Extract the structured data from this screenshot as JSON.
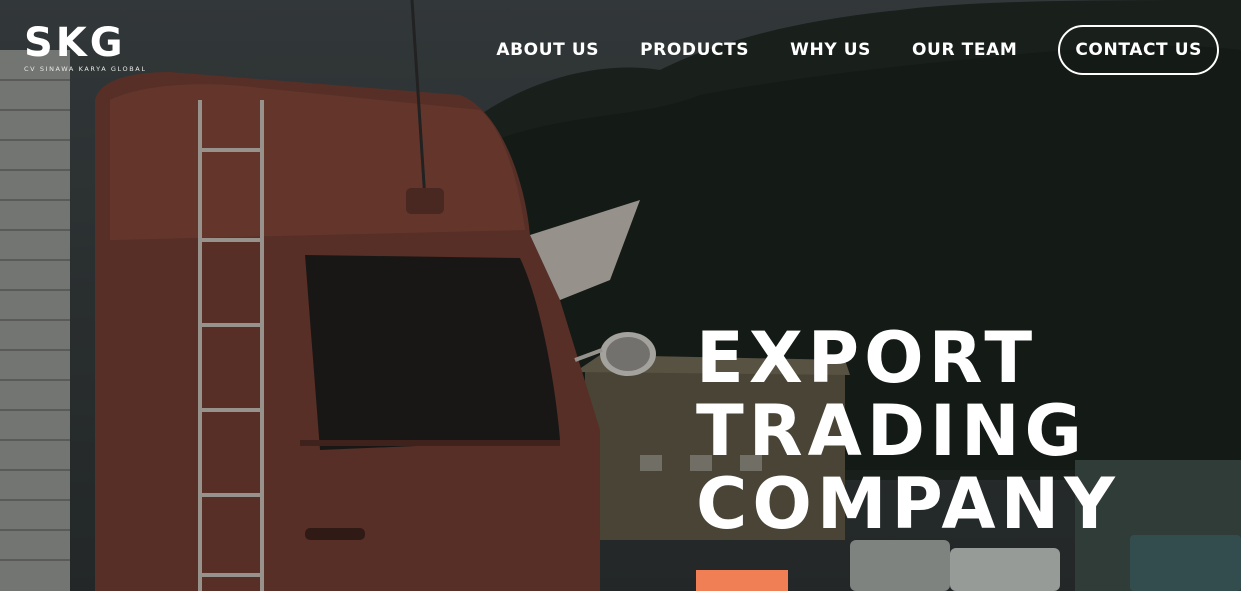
{
  "brand": {
    "logo_mark": "SKG",
    "logo_subtitle": "CV SINAWA KARYA GLOBAL"
  },
  "nav": {
    "items": [
      {
        "label": "ABOUT US"
      },
      {
        "label": "PRODUCTS"
      },
      {
        "label": "WHY US"
      },
      {
        "label": "OUR TEAM"
      }
    ],
    "cta_label": "CONTACT US"
  },
  "hero": {
    "headline_lines": [
      "EXPORT",
      "TRADING",
      "COMPANY"
    ],
    "background": "truck-photo"
  },
  "colors": {
    "accent": "#f07f55",
    "text": "#ffffff",
    "overlay": "#2b3030"
  },
  "icons": {
    "logo": "skg-logo"
  }
}
